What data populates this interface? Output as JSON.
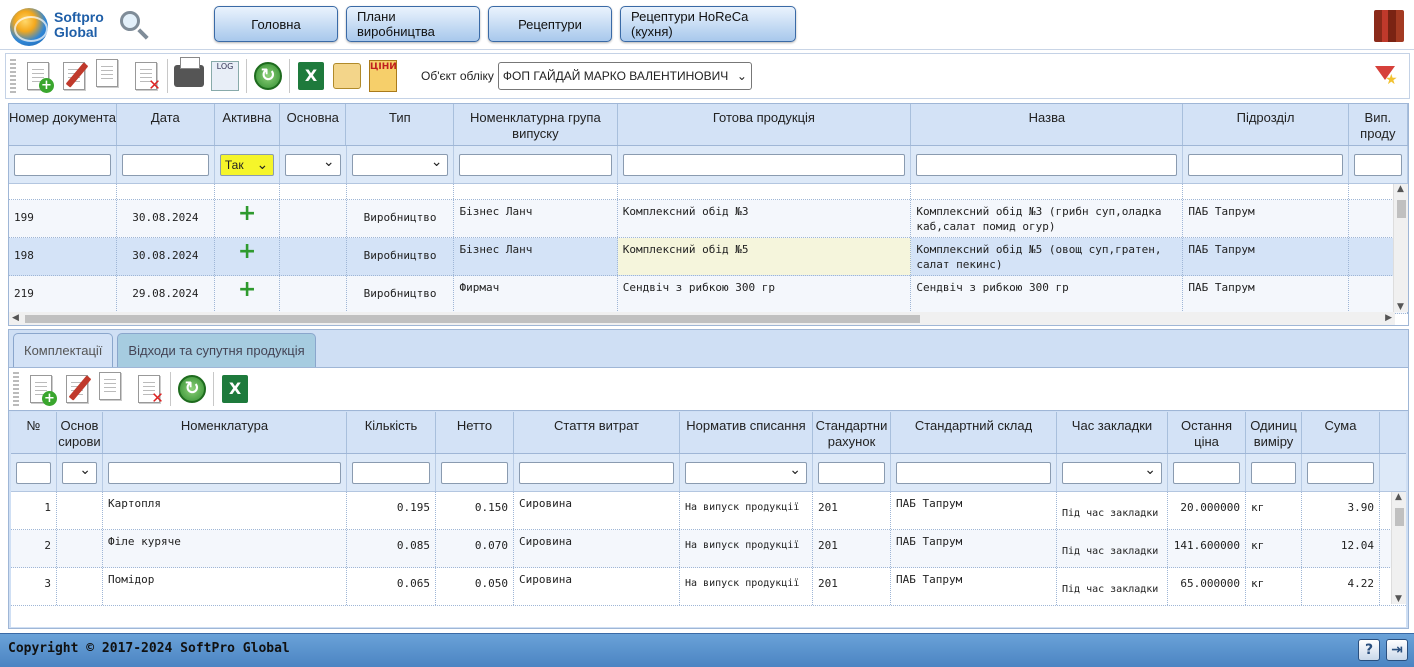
{
  "brand": {
    "line1": "Softpro",
    "line2": "Global"
  },
  "nav": [
    "Головна",
    "Плани виробництва",
    "Рецептури",
    "Рецептури HoReCa (кухня)"
  ],
  "toolbar": {
    "object_label": "Об'єкт обліку",
    "object_value": "ФОП ГАЙДАЙ МАРКО ВАЛЕНТИНОВИЧ",
    "prices_label": "ЦІНИ"
  },
  "grid1": {
    "headers": [
      "Номер документа",
      "Дата",
      "Активна",
      "Основна",
      "Тип",
      "Номенклатурна група випуску",
      "Готова продукція",
      "Назва",
      "Підрозділ",
      "Вип. проду"
    ],
    "filter_active": "Так",
    "rows": [
      {
        "num": "199",
        "date": "30.08.2024",
        "type": "Виробництво",
        "group": "Бізнес Ланч",
        "product": "Комплексний обід №3",
        "name": "Комплексний обід №3 (грибн суп,оладка каб,салат помид огур)",
        "dept": "ПАБ Тапрум"
      },
      {
        "num": "198",
        "date": "30.08.2024",
        "type": "Виробництво",
        "group": "Бізнес Ланч",
        "product": "Комплексний обід №5",
        "name": "Комплексний обід №5 (овощ суп,гратен, салат пекинс)",
        "dept": "ПАБ Тапрум"
      },
      {
        "num": "219",
        "date": "29.08.2024",
        "type": "Виробництво",
        "group": "Фирмач",
        "product": "Сендвіч з рибкою 300 гр",
        "name": "Сендвіч з рибкою 300 гр",
        "dept": "ПАБ Тапрум"
      }
    ]
  },
  "tabs": [
    "Комплектації",
    "Відходи та супутня продукція"
  ],
  "grid2": {
    "headers": [
      "№",
      "Основ сирови",
      "Номенклатура",
      "Кількість",
      "Нетто",
      "Стаття витрат",
      "Норматив списання",
      "Стандартни рахунок",
      "Стандартний склад",
      "Час закладки",
      "Остання ціна",
      "Одиниц виміру",
      "Сума"
    ],
    "rows": [
      {
        "n": "1",
        "item": "Картопля",
        "qty": "0.195",
        "net": "0.150",
        "cost": "Сировина",
        "norm": "На випуск продукції",
        "acc": "201",
        "store": "ПАБ Тапрум",
        "time": "Під час закладки",
        "price": "20.000000",
        "unit": "кг",
        "sum": "3.90"
      },
      {
        "n": "2",
        "item": "Філе куряче",
        "qty": "0.085",
        "net": "0.070",
        "cost": "Сировина",
        "norm": "На випуск продукції",
        "acc": "201",
        "store": "ПАБ Тапрум",
        "time": "Під час закладки",
        "price": "141.600000",
        "unit": "кг",
        "sum": "12.04"
      },
      {
        "n": "3",
        "item": "Помідор",
        "qty": "0.065",
        "net": "0.050",
        "cost": "Сировина",
        "norm": "На випуск продукції",
        "acc": "201",
        "store": "ПАБ Тапрум",
        "time": "Під час закладки",
        "price": "65.000000",
        "unit": "кг",
        "sum": "4.22"
      }
    ]
  },
  "footer": {
    "copyright": "Copyright © 2017-2024 SoftPro Global",
    "help": "?",
    "exit_icon": "exit-icon"
  }
}
